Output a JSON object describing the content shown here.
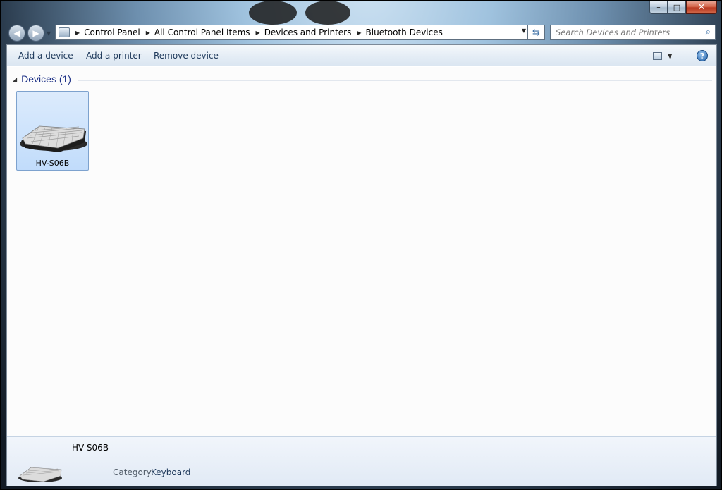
{
  "window": {
    "caption": {
      "minimize": "–",
      "maximize": "□",
      "close": "✕"
    }
  },
  "nav": {
    "back_icon": "back-arrow-icon",
    "forward_icon": "forward-arrow-icon",
    "breadcrumb": [
      "Control Panel",
      "All Control Panel Items",
      "Devices and Printers",
      "Bluetooth Devices"
    ],
    "search_placeholder": "Search Devices and Printers"
  },
  "toolbar": {
    "add_device": "Add a device",
    "add_printer": "Add a printer",
    "remove_device": "Remove device"
  },
  "groups": [
    {
      "title": "Devices (1)",
      "devices": [
        {
          "name": "HV-S06B",
          "icon": "keyboard-icon",
          "selected": true
        }
      ]
    }
  ],
  "details": {
    "name": "HV-S06B",
    "category_label": "Category:",
    "category_value": "Keyboard"
  },
  "colors": {
    "accent_title": "#1e3287",
    "selection": "#c1dcfb",
    "toolbar_text": "#1e395b"
  }
}
